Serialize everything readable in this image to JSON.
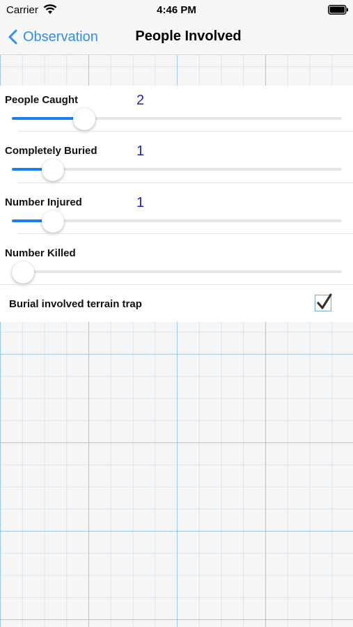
{
  "status_bar": {
    "carrier": "Carrier",
    "time": "4:46 PM"
  },
  "nav": {
    "back_label": "Observation",
    "title": "People Involved"
  },
  "sliders": [
    {
      "label": "People Caught",
      "value": "2",
      "fraction": 0.22
    },
    {
      "label": "Completely Buried",
      "value": "1",
      "fraction": 0.125
    },
    {
      "label": "Number Injured",
      "value": "1",
      "fraction": 0.125
    },
    {
      "label": "Number Killed",
      "value": "",
      "fraction": 0.03
    }
  ],
  "checkbox": {
    "label": "Burial involved terrain trap",
    "checked": true
  },
  "colors": {
    "accent": "#1a7ff5",
    "value_text": "#2020c8",
    "back": "#2f8ff0"
  }
}
